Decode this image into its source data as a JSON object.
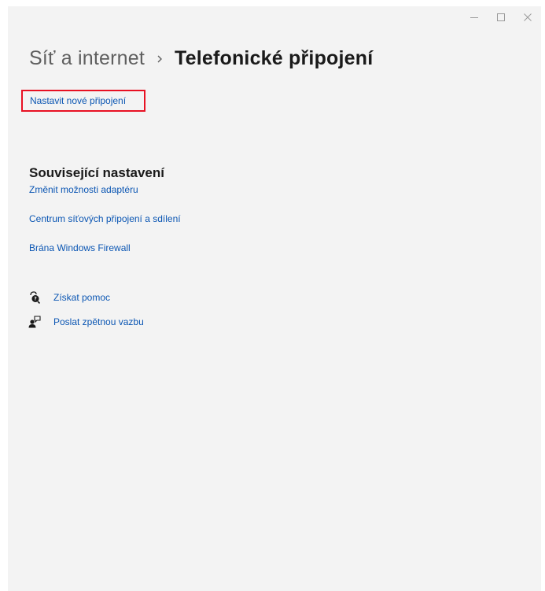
{
  "window": {
    "caption_buttons": {
      "minimize_icon": "minimize-icon",
      "maximize_icon": "maximize-icon",
      "close_icon": "close-icon"
    }
  },
  "breadcrumb": {
    "parent": "Síť a internet",
    "separator_icon": "chevron-right-icon",
    "current": "Telefonické připojení"
  },
  "main": {
    "setup_link": "Nastavit nové připojení"
  },
  "related": {
    "title": "Související nastavení",
    "links": [
      "Změnit možnosti adaptéru",
      "Centrum síťových připojení a sdílení",
      "Brána Windows Firewall"
    ]
  },
  "help": {
    "items": [
      {
        "icon": "get-help-icon",
        "label": "Získat pomoc"
      },
      {
        "icon": "feedback-icon",
        "label": "Poslat zpětnou vazbu"
      }
    ]
  },
  "colors": {
    "link": "#0b56b3",
    "highlight": "#e81123",
    "background": "#f3f3f3"
  }
}
